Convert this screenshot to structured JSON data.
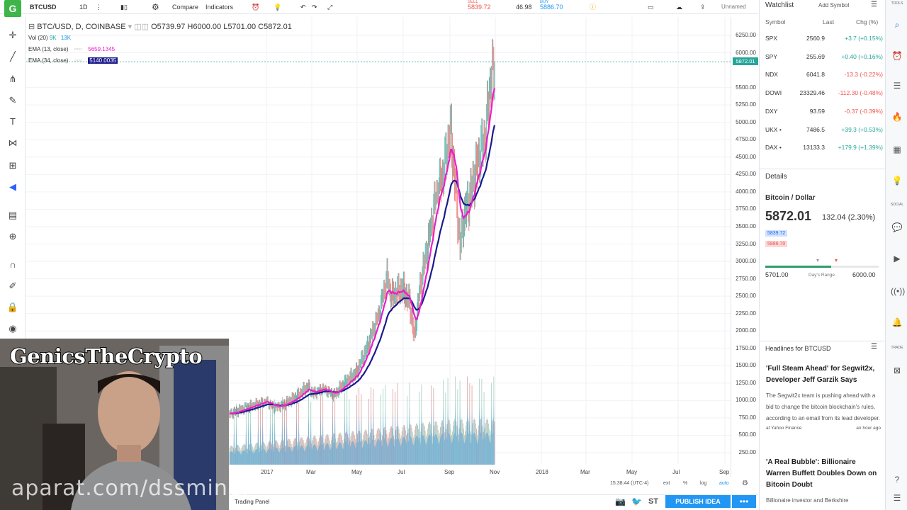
{
  "toolbar": {
    "symbol": "BTCUSD",
    "interval": "1D",
    "compare": "Compare",
    "indicators": "Indicators",
    "sell_label": "SELL",
    "sell_price": "5839.72",
    "spread": "46.98",
    "buy_label": "BUY",
    "buy_price": "5886.70",
    "layout_name": "Unnamed"
  },
  "legend": {
    "title": "BTC/USD, D, COINBASE",
    "ohlc": "O5739.97 H6000.00 L5701.00 C5872.01",
    "vol_label": "Vol (20)",
    "vol_a": "9K",
    "vol_b": "13K",
    "ema1_label": "EMA (13, close)",
    "ema1_value": "5659.1345",
    "ema2_label": "EMA (34, close)",
    "ema2_value": "5140.0035"
  },
  "price_axis": {
    "ticks": [
      "6250.00",
      "6000.00",
      "5500.00",
      "5250.00",
      "5000.00",
      "4750.00",
      "4500.00",
      "4250.00",
      "4000.00",
      "3750.00",
      "3500.00",
      "3250.00",
      "3000.00",
      "2750.00",
      "2500.00",
      "2250.00",
      "2000.00",
      "1750.00",
      "1500.00",
      "1250.00",
      "1000.00",
      "750.00",
      "500.00",
      "250.00"
    ],
    "current_label": "5872.01"
  },
  "time_axis": {
    "ticks": [
      "2017",
      "Mar",
      "May",
      "Jul",
      "Sep",
      "Nov",
      "2018",
      "Mar",
      "May",
      "Jul",
      "Sep"
    ]
  },
  "bottombar": {
    "time": "15:38:44 (UTC-4)",
    "ext": "ext",
    "pct": "%",
    "log": "log",
    "auto": "auto"
  },
  "panelbar": {
    "trading_panel": "Trading Panel",
    "publish": "PUBLISH IDEA"
  },
  "webcam": {
    "title": "GenicsTheCrypto"
  },
  "watermark": "aparat.com/dssminer",
  "watchlist": {
    "title": "Watchlist",
    "add_symbol": "Add Symbol",
    "col_symbol": "Symbol",
    "col_last": "Last",
    "col_chg": "Chg (%)",
    "rows": [
      {
        "symbol": "SPX",
        "last": "2560.9",
        "chg": "+3.7 (+0.15%)",
        "dir": "up"
      },
      {
        "symbol": "SPY",
        "last": "255.69",
        "chg": "+0.40 (+0.16%)",
        "dir": "up"
      },
      {
        "symbol": "NDX",
        "last": "6041.8",
        "chg": "-13.3 (-0.22%)",
        "dir": "down"
      },
      {
        "symbol": "DOWI",
        "last": "23329.46",
        "chg": "-112.30 (-0.48%)",
        "dir": "down"
      },
      {
        "symbol": "DXY",
        "last": "93.59",
        "chg": "-0.37 (-0.39%)",
        "dir": "down"
      },
      {
        "symbol": "UKX •",
        "last": "7486.5",
        "chg": "+39.3 (+0.53%)",
        "dir": "up"
      },
      {
        "symbol": "DAX •",
        "last": "13133.3",
        "chg": "+179.9 (+1.39%)",
        "dir": "up"
      }
    ]
  },
  "details": {
    "header": "Details",
    "name": "Bitcoin / Dollar",
    "price": "5872.01",
    "change": "132.04 (2.30%)",
    "bid": "5839.72",
    "ask": "5886.70",
    "day_low": "5701.00",
    "day_high": "6000.00",
    "range_label": "Day's Range"
  },
  "headlines": {
    "header": "Headlines for BTCUSD",
    "items": [
      {
        "title": "'Full Steam Ahead' for Segwit2x, Developer Jeff Garzik Says",
        "body": "The Segwit2x team is pushing ahead with a bid to change the bitcoin blockchain's rules, according to an email from its lead developer.",
        "source": "at Yahoo Finance",
        "time": "an hour ago"
      },
      {
        "title": "'A Real Bubble': Billionaire Warren Buffett Doubles Down on Bitcoin Doubt",
        "body": "Billionaire investor and Berkshire",
        "source": "",
        "time": ""
      }
    ]
  },
  "rightbar": {
    "tools": "TOOLS",
    "social": "SOCIAL",
    "trade": "TRADE"
  },
  "colors": {
    "ema13": "#e91ec8",
    "ema34": "#1a1a8c",
    "up": "#26a69a",
    "down": "#ef5350",
    "accent": "#2196f3",
    "volume": "#4fa3d9"
  }
}
